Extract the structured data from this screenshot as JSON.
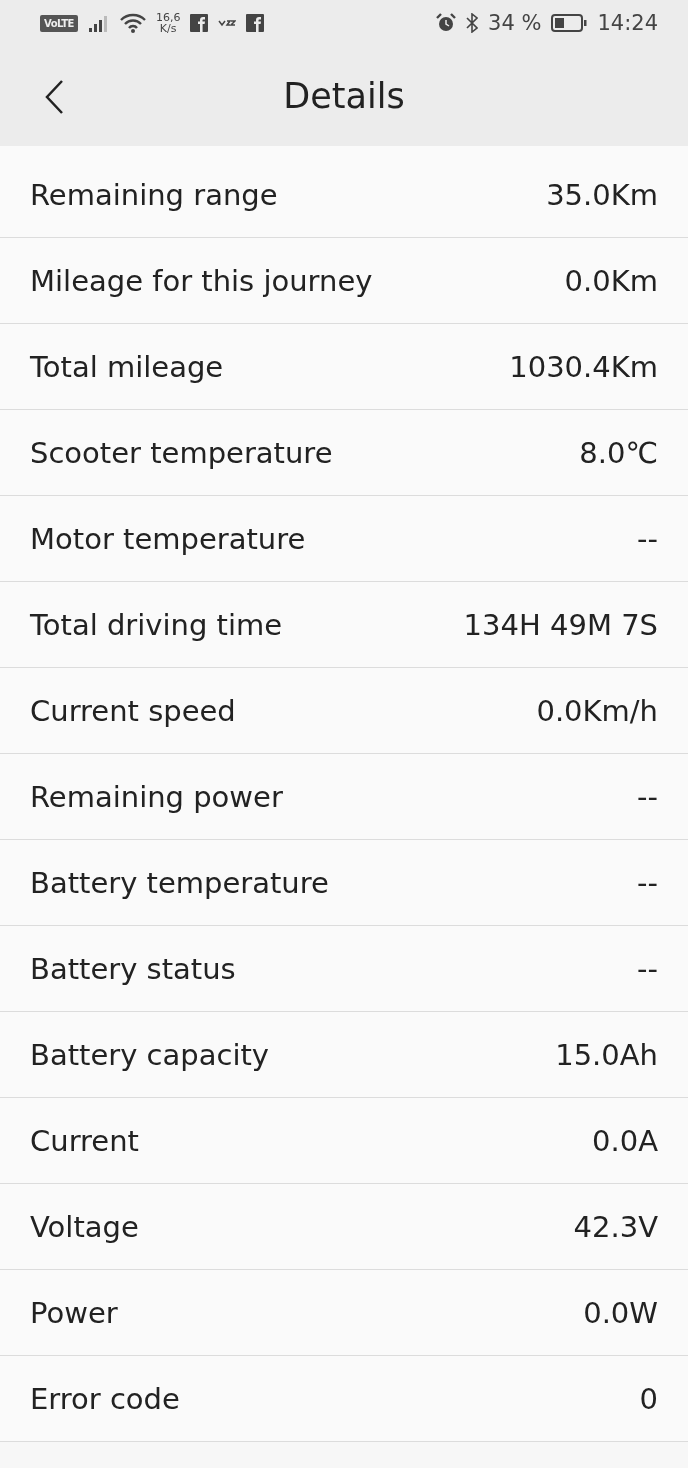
{
  "status_bar": {
    "volte": "VoLTE",
    "speed_value": "16,6",
    "speed_unit": "K/s",
    "battery": "34 %",
    "time": "14:24"
  },
  "header": {
    "title": "Details"
  },
  "rows": [
    {
      "label": "Remaining range",
      "value": "35.0Km"
    },
    {
      "label": "Mileage for this journey",
      "value": "0.0Km"
    },
    {
      "label": "Total mileage",
      "value": "1030.4Km"
    },
    {
      "label": "Scooter temperature",
      "value": "8.0℃"
    },
    {
      "label": "Motor temperature",
      "value": "--"
    },
    {
      "label": "Total driving time",
      "value": "134H 49M 7S"
    },
    {
      "label": "Current speed",
      "value": "0.0Km/h"
    },
    {
      "label": "Remaining power",
      "value": "--"
    },
    {
      "label": "Battery temperature",
      "value": "--"
    },
    {
      "label": "Battery status",
      "value": "--"
    },
    {
      "label": "Battery capacity",
      "value": "15.0Ah"
    },
    {
      "label": "Current",
      "value": "0.0A"
    },
    {
      "label": "Voltage",
      "value": "42.3V"
    },
    {
      "label": "Power",
      "value": "0.0W"
    },
    {
      "label": "Error code",
      "value": "0"
    }
  ]
}
